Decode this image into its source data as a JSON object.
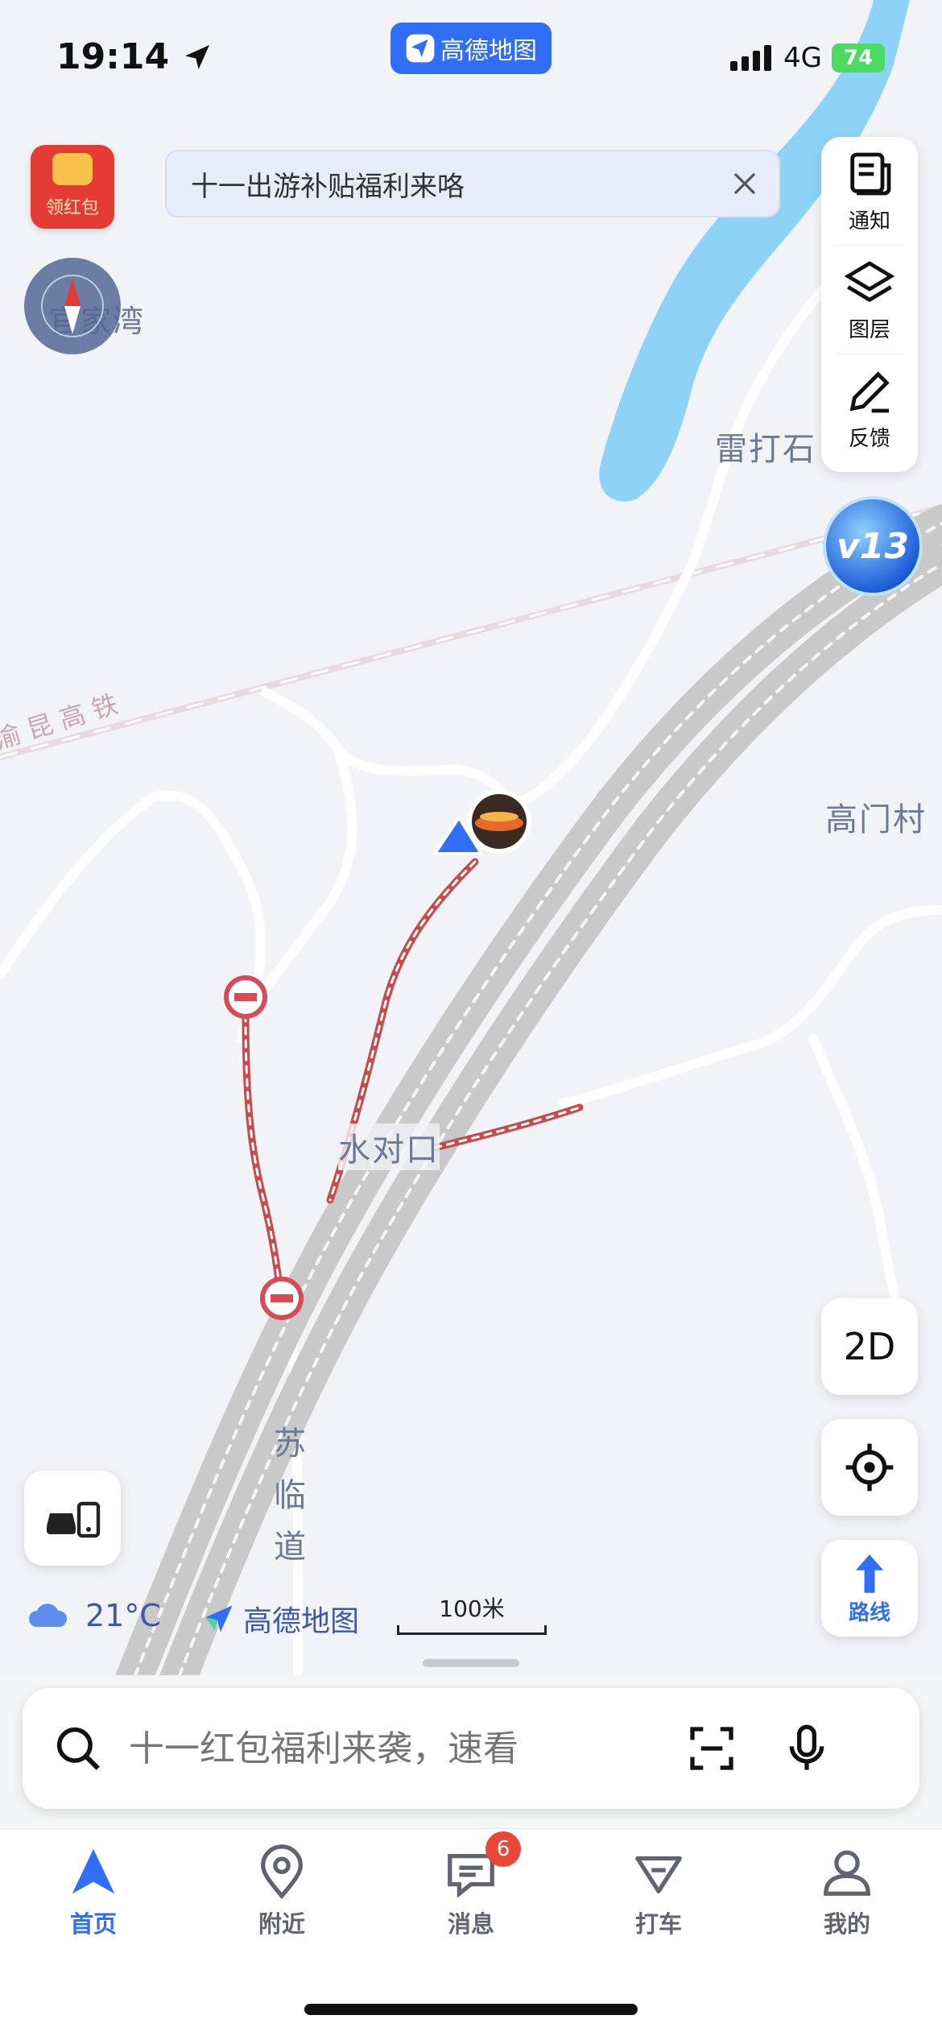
{
  "status_bar": {
    "time": "19:14",
    "network": "4G",
    "battery": "74"
  },
  "app_badge": {
    "label": "高德地图"
  },
  "promo_banner": {
    "text": "十一出游补贴福利来咯"
  },
  "red_packet": {
    "label": "领红包"
  },
  "right_tools": [
    {
      "label": "通知",
      "icon": "notice-icon"
    },
    {
      "label": "图层",
      "icon": "layers-icon"
    },
    {
      "label": "反馈",
      "icon": "feedback-icon"
    }
  ],
  "level_badge": {
    "text": "v13"
  },
  "map_labels": {
    "guanjiawan": "官家湾",
    "leidashi": "雷打石",
    "gaomencun": "高门村",
    "shuiduikou": "水对口",
    "sulindao": [
      "苏",
      "临",
      "道"
    ],
    "railway": "渝昆高铁"
  },
  "view_controls": {
    "mode_2d": "2D",
    "route_label": "路线"
  },
  "weather": {
    "temperature": "21°C"
  },
  "brand": {
    "label": "高德地图"
  },
  "scale": {
    "label": "100米"
  },
  "search": {
    "placeholder": "十一红包福利来袭，速看"
  },
  "tabs": [
    {
      "label": "首页",
      "icon": "home-nav-icon",
      "active": true
    },
    {
      "label": "附近",
      "icon": "location-pin-icon",
      "active": false
    },
    {
      "label": "消息",
      "icon": "message-icon",
      "active": false,
      "badge": "6"
    },
    {
      "label": "打车",
      "icon": "taxi-icon",
      "active": false
    },
    {
      "label": "我的",
      "icon": "user-icon",
      "active": false
    }
  ],
  "colors": {
    "accent": "#2f6ef5",
    "river": "#8dd3f8",
    "road": "#c9c9c9",
    "badge": "#e8473a"
  }
}
